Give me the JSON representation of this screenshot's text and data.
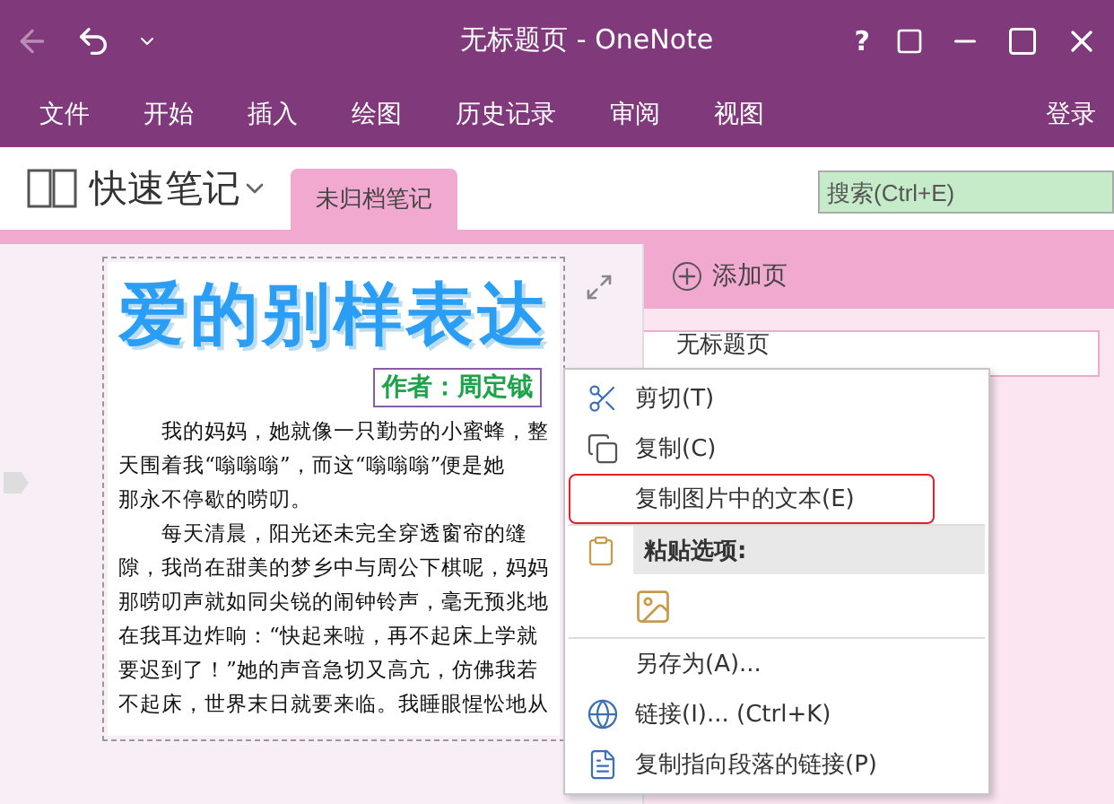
{
  "window": {
    "title": "无标题页 - OneNote",
    "help": "?"
  },
  "ribbon_tabs": [
    {
      "label": "文件"
    },
    {
      "label": "开始"
    },
    {
      "label": "插入"
    },
    {
      "label": "绘图"
    },
    {
      "label": "历史记录"
    },
    {
      "label": "审阅"
    },
    {
      "label": "视图"
    }
  ],
  "sign_in": "登录",
  "notebook": {
    "name": "快速笔记"
  },
  "section_tabs": [
    {
      "label": "未归档笔记",
      "selected": true
    }
  ],
  "search": {
    "placeholder": "搜索(Ctrl+E)"
  },
  "page_pane": {
    "add_page": "添加页",
    "pages": [
      {
        "title": "无标题页",
        "selected": true
      }
    ]
  },
  "note_image": {
    "title": "爱的别样表达",
    "author": "作者：周定钺",
    "paragraphs": [
      [
        "我的妈妈，她就像一只勤劳的小蜜蜂，整",
        "天围着我“嗡嗡嗡”，而这“嗡嗡嗡”便是她",
        "那永不停歇的唠叨。"
      ],
      [
        "每天清晨，阳光还未完全穿透窗帘的缝",
        "隙，我尚在甜美的梦乡中与周公下棋呢，妈妈",
        "那唠叨声就如同尖锐的闹钟铃声，毫无预兆地",
        "在我耳边炸响：“快起来啦，再不起床上学就",
        "要迟到了！”她的声音急切又高亢，仿佛我若",
        "不起床，世界末日就要来临。我睡眼惺忪地从"
      ]
    ]
  },
  "context_menu": [
    {
      "kind": "item",
      "label": "剪切(T)",
      "highlighted": false
    },
    {
      "kind": "item",
      "label": "复制(C)",
      "highlighted": false
    },
    {
      "kind": "item",
      "label": "复制图片中的文本(E)",
      "highlighted": true
    },
    {
      "kind": "header",
      "label": "粘贴选项:"
    },
    {
      "kind": "paste"
    },
    {
      "kind": "item",
      "label": "另存为(A)...",
      "highlighted": false
    },
    {
      "kind": "item",
      "label": "链接(I)...  (Ctrl+K)",
      "highlighted": false
    },
    {
      "kind": "item",
      "label": "复制指向段落的链接(P)",
      "highlighted": false
    }
  ]
}
